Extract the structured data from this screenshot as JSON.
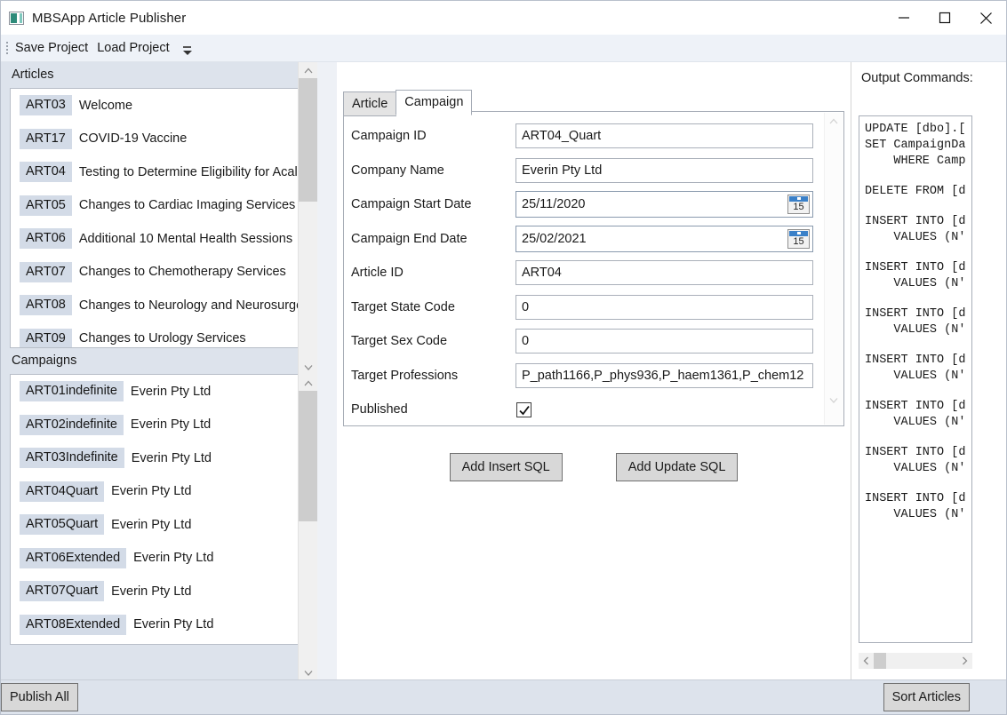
{
  "window": {
    "title": "MBSApp Article Publisher",
    "icon": "app-icon",
    "minimize": "—",
    "maximize": "☐",
    "close": "✕"
  },
  "toolbar": {
    "save_project": "Save Project",
    "load_project": "Load Project",
    "overflow": "overflow-chevron"
  },
  "articles_panel": {
    "label": "Articles",
    "items": [
      {
        "id": "ART03",
        "title": "Welcome"
      },
      {
        "id": "ART17",
        "title": "COVID-19 Vaccine"
      },
      {
        "id": "ART04",
        "title": "Testing to Determine Eligibility for Acalab"
      },
      {
        "id": "ART05",
        "title": "Changes to Cardiac Imaging Services"
      },
      {
        "id": "ART06",
        "title": "Additional 10 Mental Health Sessions"
      },
      {
        "id": "ART07",
        "title": "Changes to Chemotherapy Services"
      },
      {
        "id": "ART08",
        "title": "Changes to Neurology and Neurosurgery"
      },
      {
        "id": "ART09",
        "title": "Changes to Urology Services"
      }
    ]
  },
  "campaigns_panel": {
    "label": "Campaigns",
    "items": [
      {
        "id": "ART01indefinite",
        "company": "Everin Pty Ltd"
      },
      {
        "id": "ART02indefinite",
        "company": "Everin Pty Ltd"
      },
      {
        "id": "ART03Indefinite",
        "company": "Everin Pty Ltd"
      },
      {
        "id": "ART04Quart",
        "company": "Everin Pty Ltd"
      },
      {
        "id": "ART05Quart",
        "company": "Everin Pty Ltd"
      },
      {
        "id": "ART06Extended",
        "company": "Everin Pty Ltd"
      },
      {
        "id": "ART07Quart",
        "company": "Everin Pty Ltd"
      },
      {
        "id": "ART08Extended",
        "company": "Everin Pty Ltd"
      }
    ]
  },
  "tabs": {
    "article": "Article",
    "campaign": "Campaign",
    "selected": "Campaign"
  },
  "form": {
    "fields": [
      {
        "label": "Campaign ID",
        "value": "ART04_Quart",
        "type": "text"
      },
      {
        "label": "Company Name",
        "value": "Everin Pty Ltd",
        "type": "text"
      },
      {
        "label": "Campaign Start Date",
        "value": "25/11/2020",
        "type": "date"
      },
      {
        "label": "Campaign End Date",
        "value": "25/02/2021",
        "type": "date"
      },
      {
        "label": "Article ID",
        "value": "ART04",
        "type": "text"
      },
      {
        "label": "Target State Code",
        "value": "0",
        "type": "text"
      },
      {
        "label": "Target Sex Code",
        "value": "0",
        "type": "text"
      },
      {
        "label": "Target Professions",
        "value": "P_path1166,P_phys936,P_haem1361,P_chem12",
        "type": "text"
      },
      {
        "label": "Published",
        "value": true,
        "type": "checkbox"
      }
    ],
    "calendar_icon_day": "15"
  },
  "actions": {
    "add_insert_sql": "Add Insert SQL",
    "add_update_sql": "Add Update SQL"
  },
  "output": {
    "label": "Output Commands:",
    "blocks": [
      [
        "UPDATE [dbo].[",
        "SET CampaignDa",
        "    WHERE Camp"
      ],
      [
        "DELETE FROM [d"
      ],
      [
        "INSERT INTO [d",
        "    VALUES (N'"
      ],
      [
        "INSERT INTO [d",
        "    VALUES (N'"
      ],
      [
        "INSERT INTO [d",
        "    VALUES (N'"
      ],
      [
        "INSERT INTO [d",
        "    VALUES (N'"
      ],
      [
        "INSERT INTO [d",
        "    VALUES (N'"
      ],
      [
        "INSERT INTO [d",
        "    VALUES (N'"
      ],
      [
        "INSERT INTO [d",
        "    VALUES (N'"
      ]
    ]
  },
  "bottom": {
    "publish_all": "Publish All",
    "sort_articles": "Sort Articles"
  },
  "colors": {
    "badge": "#d3dbe7",
    "panel": "#dde3ec",
    "button": "#d8d8d8",
    "calendar_header": "#3a80c8"
  }
}
